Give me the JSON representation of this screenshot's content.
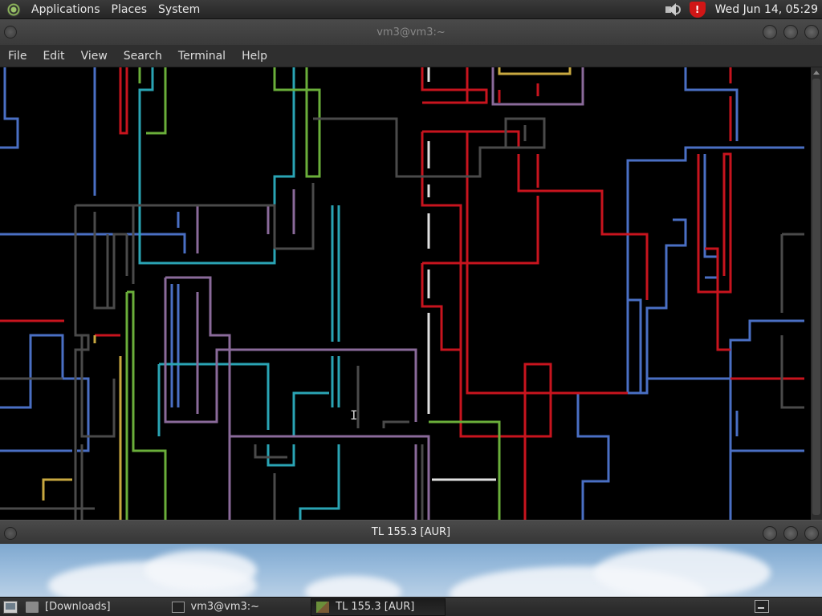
{
  "top_panel": {
    "menus": [
      "Applications",
      "Places",
      "System"
    ],
    "clock": "Wed Jun 14, 05:29",
    "icons": [
      "distro-logo-icon",
      "volume-icon",
      "update-shield-icon"
    ]
  },
  "terminal_window": {
    "title": "vm3@vm3:~",
    "menu": [
      "File",
      "Edit",
      "View",
      "Search",
      "Terminal",
      "Help"
    ],
    "content": "pipes screensaver animation (colored line drawings)",
    "pipe_colors": {
      "blue": "#4a6fc4",
      "red": "#c8141e",
      "teal": "#2aa4b4",
      "green": "#6aae3a",
      "purple": "#8a6a9a",
      "gray": "#4a4a4a",
      "white": "#e0e0e0",
      "yellow": "#c8a840"
    }
  },
  "tl_window": {
    "title": "TL 155.3 [AUR]"
  },
  "taskbar": {
    "tasks": [
      {
        "label": "[Downloads]",
        "icon": "folder-icon",
        "active": false
      },
      {
        "label": "vm3@vm3:~",
        "icon": "terminal-icon",
        "active": false
      },
      {
        "label": "TL 155.3 [AUR]",
        "icon": "game-icon",
        "active": true
      }
    ]
  }
}
